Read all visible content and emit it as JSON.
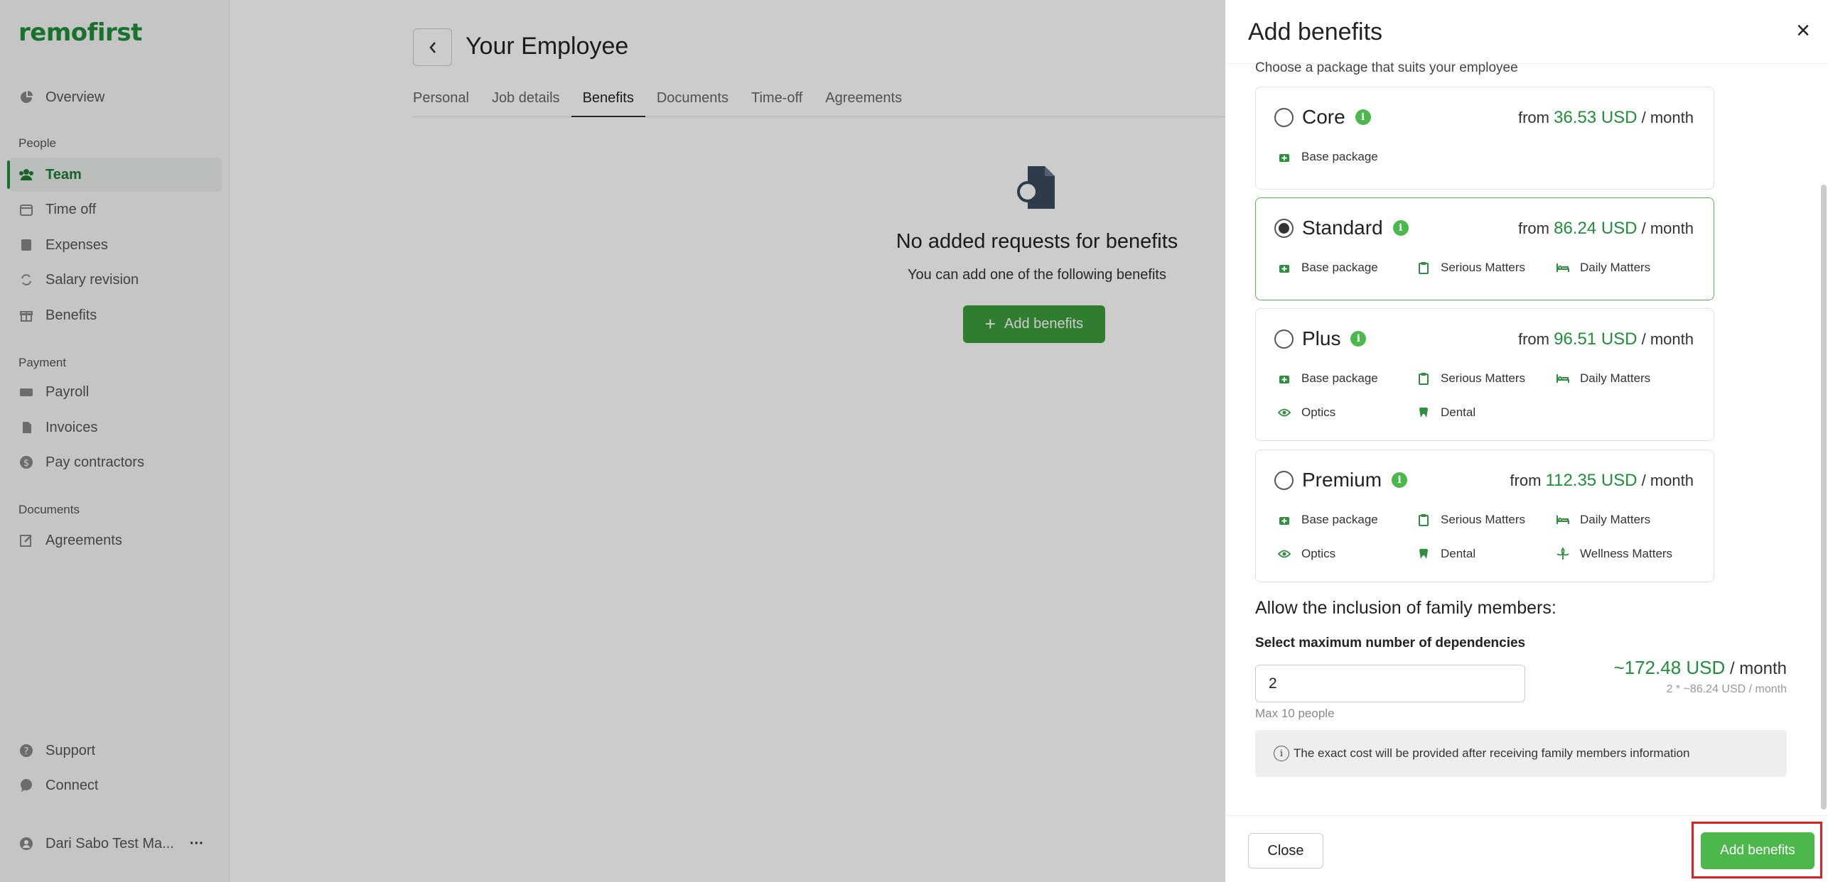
{
  "sidebar": {
    "logo": "remofirst",
    "overview": "Overview",
    "section_people": "People",
    "team": "Team",
    "time_off": "Time off",
    "expenses": "Expenses",
    "salary_revision": "Salary revision",
    "benefits": "Benefits",
    "section_payment": "Payment",
    "payroll": "Payroll",
    "invoices": "Invoices",
    "pay_contractors": "Pay contractors",
    "section_documents": "Documents",
    "agreements": "Agreements",
    "support": "Support",
    "connect": "Connect",
    "user": "Dari Sabo Test Ma...",
    "more": "···"
  },
  "main": {
    "title": "Your Employee",
    "tabs": [
      "Personal",
      "Job details",
      "Benefits",
      "Documents",
      "Time-off",
      "Agreements"
    ],
    "empty_title": "No added requests for benefits",
    "empty_sub": "You can add one of the following benefits",
    "add_button": "Add benefits",
    "add_plus": "+"
  },
  "drawer": {
    "title": "Add benefits",
    "close_x": "×",
    "choose": "Choose a package that suits your employee",
    "packages": [
      {
        "name": "Core",
        "from": "from",
        "amount": "36.53 USD",
        "per": "/ month",
        "selected": false,
        "features": [
          "Base package"
        ]
      },
      {
        "name": "Standard",
        "from": "from",
        "amount": "86.24 USD",
        "per": "/ month",
        "selected": true,
        "features": [
          "Base package",
          "Serious Matters",
          "Daily Matters"
        ]
      },
      {
        "name": "Plus",
        "from": "from",
        "amount": "96.51 USD",
        "per": "/ month",
        "selected": false,
        "features": [
          "Base package",
          "Serious Matters",
          "Daily Matters",
          "Optics",
          "Dental"
        ]
      },
      {
        "name": "Premium",
        "from": "from",
        "amount": "112.35 USD",
        "per": "/ month",
        "selected": false,
        "features": [
          "Base package",
          "Serious Matters",
          "Daily Matters",
          "Optics",
          "Dental",
          "Wellness Matters"
        ]
      }
    ],
    "family_title": "Allow the inclusion of family members:",
    "deps_label": "Select maximum number of dependencies",
    "deps_value": "2",
    "max_note": "Max 10 people",
    "family_amount": "~172.48 USD",
    "family_per": "/ month",
    "family_calc": "2 * ~86.24 USD / month",
    "notice": "The exact cost will be provided after receiving family members information",
    "close_button": "Close",
    "submit_button": "Add benefits"
  },
  "colors": {
    "accent": "#1f8f3a",
    "button_green": "#4cb84c",
    "highlight": "#e02020"
  },
  "icons": [
    "overview-icon",
    "team-icon",
    "calendar-icon",
    "expenses-icon",
    "salary-revision-icon",
    "gift-icon",
    "payroll-icon",
    "invoices-icon",
    "dollar-icon",
    "edit-icon",
    "help-icon",
    "chat-icon",
    "user-icon",
    "document-search-icon",
    "medkit-icon",
    "clipboard-icon",
    "bed-icon",
    "eye-icon",
    "tooth-icon",
    "wellness-icon"
  ]
}
